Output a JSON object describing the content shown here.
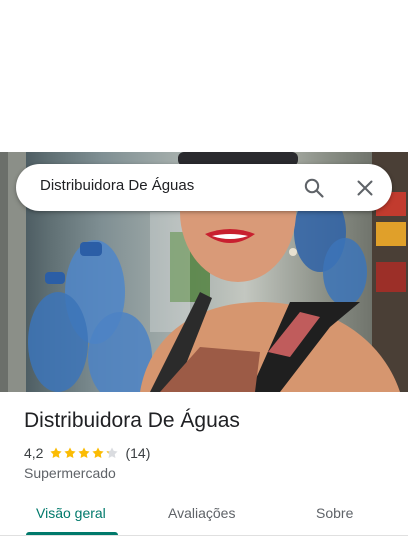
{
  "search": {
    "query": "Distribuidora De Águas"
  },
  "place": {
    "title": "Distribuidora De Águas",
    "rating_value": "4,2",
    "rating": 4.2,
    "rating_max": 5,
    "review_count": "(14)",
    "category": "Supermercado"
  },
  "tabs": [
    {
      "label": "Visão geral",
      "active": true
    },
    {
      "label": "Avaliações",
      "active": false
    },
    {
      "label": "Sobre",
      "active": false
    }
  ],
  "colors": {
    "accent": "#00796b",
    "star": "#fbbc04",
    "star_empty": "#dadce0"
  },
  "icons": {
    "search": "search-icon",
    "close": "close-icon"
  }
}
